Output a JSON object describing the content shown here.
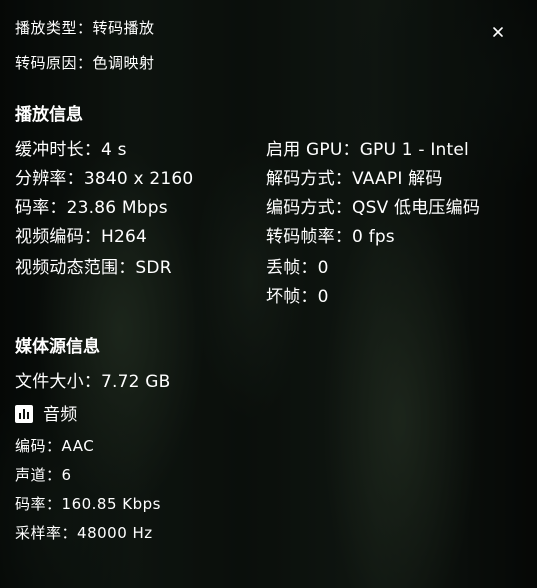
{
  "playback": {
    "play_type_label": "播放类型",
    "play_type_value": "转码播放",
    "transcode_reason_label": "转码原因",
    "transcode_reason_value": "色调映射"
  },
  "playback_info": {
    "title": "播放信息",
    "left": [
      {
        "label": "缓冲时长",
        "value": "4 s"
      },
      {
        "label": "分辨率",
        "value": "3840 x 2160"
      },
      {
        "label": "码率",
        "value": "23.86 Mbps"
      },
      {
        "label": "视频编码",
        "value": "H264"
      },
      {
        "label": "视频动态范围",
        "value": "SDR"
      }
    ],
    "right": [
      {
        "label": "启用 GPU",
        "value": "GPU 1 - Intel"
      },
      {
        "label": "解码方式",
        "value": "VAAPI 解码"
      },
      {
        "label": "编码方式",
        "value": "QSV 低电压编码"
      },
      {
        "label": "转码帧率",
        "value": "0 fps"
      },
      {
        "label": "丢帧",
        "value": "0"
      },
      {
        "label": "坏帧",
        "value": "0"
      }
    ]
  },
  "media_info": {
    "title": "媒体源信息",
    "file_size_label": "文件大小",
    "file_size_value": "7.72 GB",
    "audio_title": "音频",
    "audio_icon": "audio-waveform-icon",
    "audio": [
      {
        "label": "编码",
        "value": "AAC"
      },
      {
        "label": "声道",
        "value": "6"
      },
      {
        "label": "码率",
        "value": "160.85 Kbps"
      },
      {
        "label": "采样率",
        "value": "48000 Hz"
      }
    ]
  },
  "close_icon": "close-icon"
}
